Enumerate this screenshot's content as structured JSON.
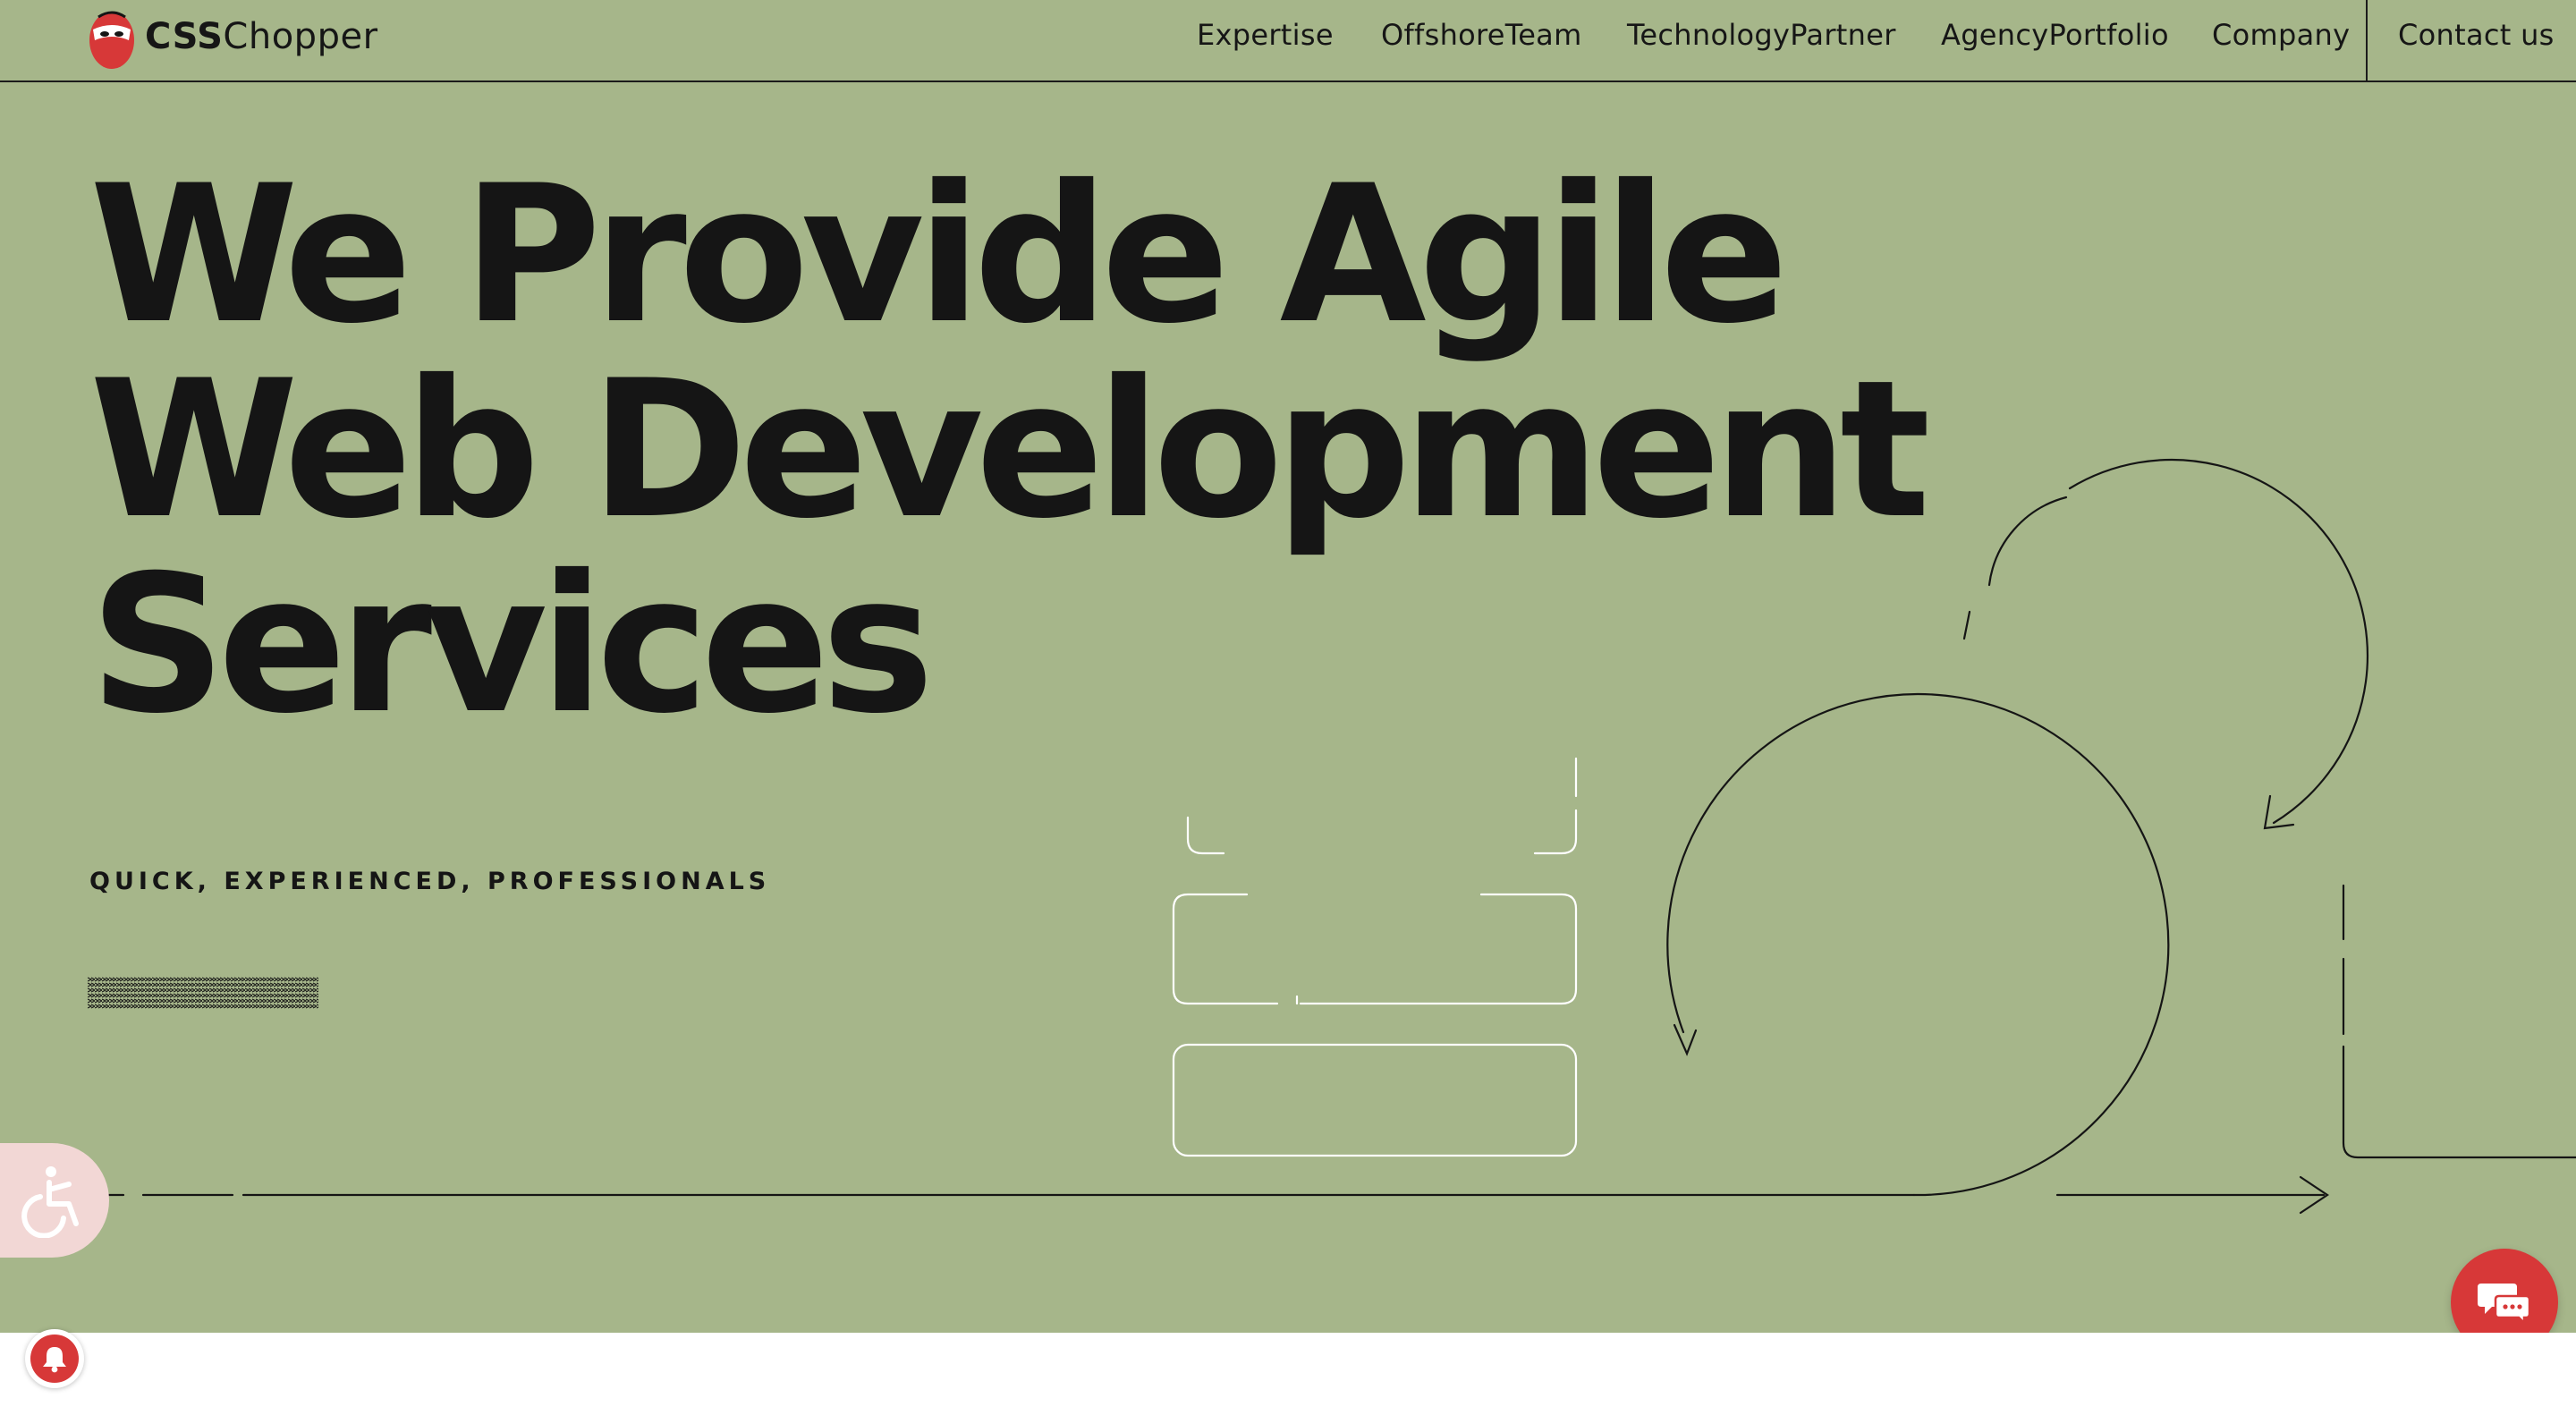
{
  "header": {
    "logo_bold": "CSS",
    "logo_regular": "Chopper",
    "nav": [
      {
        "label": "Expertise"
      },
      {
        "label": "OffshoreTeam"
      },
      {
        "label": "TechnologyPartner"
      },
      {
        "label": "AgencyPortfolio"
      },
      {
        "label": "Company"
      }
    ],
    "contact_label": "Contact us"
  },
  "hero": {
    "headline_lines": [
      "We Provide Agile",
      "Web Development",
      "Services"
    ],
    "tagline": "QUICK, EXPERIENCED, PROFESSIONALS",
    "background_color": "#a6b68a"
  },
  "widgets": {
    "accessibility_icon": "wheelchair-icon",
    "chat_icon": "chat-bubbles-icon",
    "notification_icon": "bell-icon",
    "accent_color": "#d73838"
  }
}
